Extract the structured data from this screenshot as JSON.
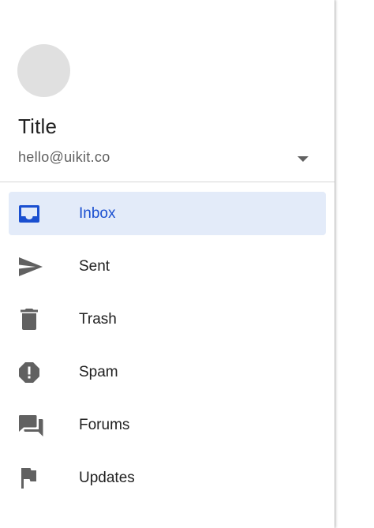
{
  "account": {
    "title": "Title",
    "email": "hello@uikit.co",
    "dropdown_icon": "arrow-drop-down-icon"
  },
  "nav": {
    "items": [
      {
        "label": "Inbox",
        "icon": "inbox-icon",
        "active": true
      },
      {
        "label": "Sent",
        "icon": "send-icon",
        "active": false
      },
      {
        "label": "Trash",
        "icon": "trash-icon",
        "active": false
      },
      {
        "label": "Spam",
        "icon": "spam-icon",
        "active": false
      },
      {
        "label": "Forums",
        "icon": "forums-icon",
        "active": false
      },
      {
        "label": "Updates",
        "icon": "updates-icon",
        "active": false
      }
    ]
  },
  "colors": {
    "accent": "#1a4fd0",
    "active_background": "#e3ebf9",
    "icon": "#616161",
    "avatar": "#e0e0e0"
  }
}
